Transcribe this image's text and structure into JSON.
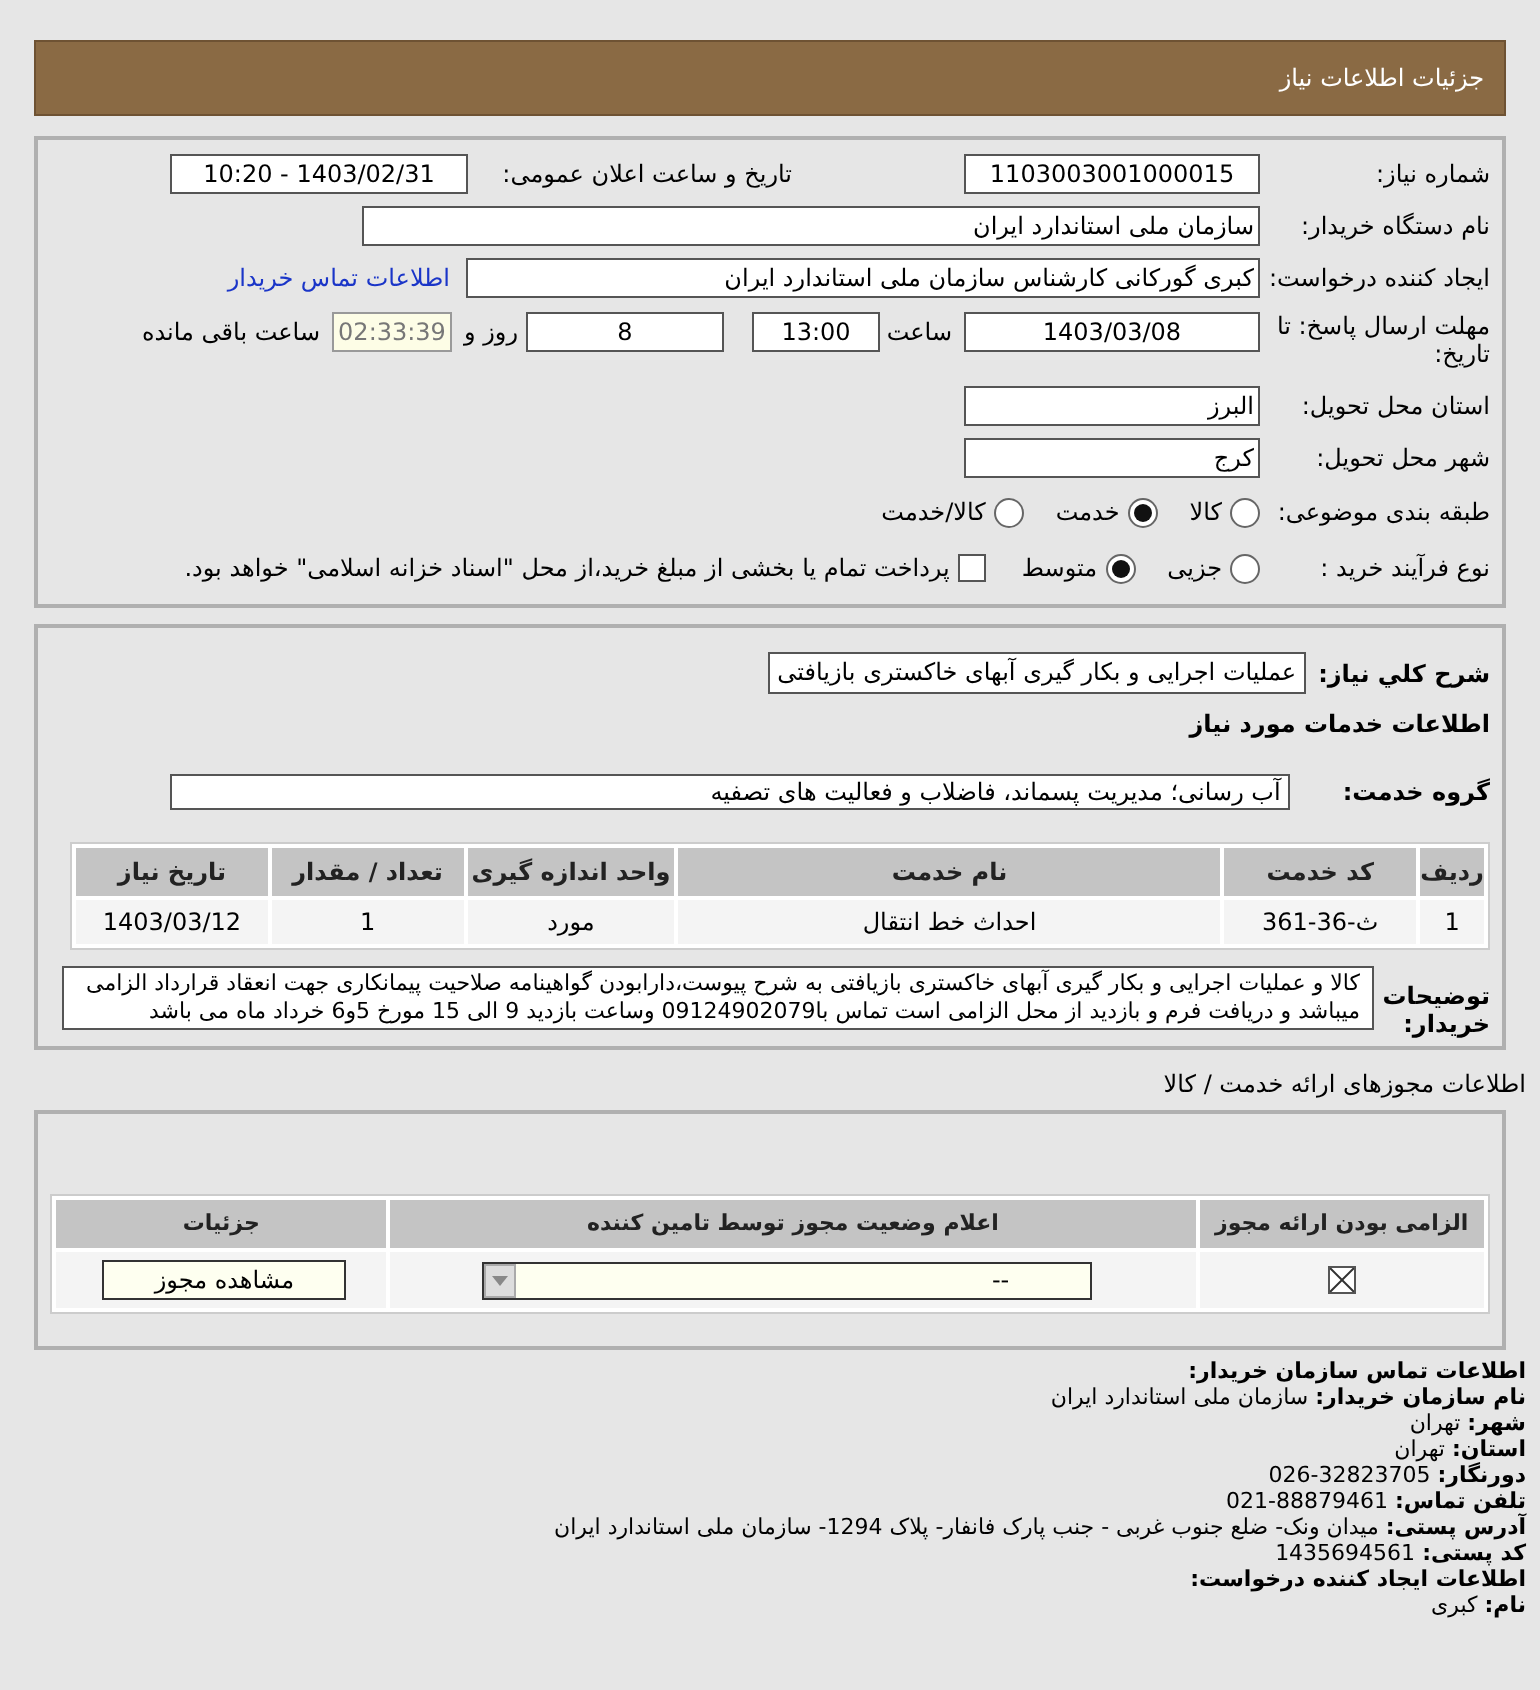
{
  "header": {
    "title": "جزئیات اطلاعات نیاز"
  },
  "need_number": {
    "label": "شماره نیاز:",
    "value": "1103003001000015"
  },
  "announce_date": {
    "label": "تاریخ و ساعت اعلان عمومی:",
    "value": "1403/02/31 - 10:20"
  },
  "buyer_org": {
    "label": "نام دستگاه خریدار:",
    "value": "سازمان ملی استاندارد ایران"
  },
  "requester": {
    "label": "ایجاد کننده درخواست:",
    "value": "کبری گورکانی کارشناس سازمان ملی استاندارد ایران",
    "link": "اطلاعات تماس خریدار"
  },
  "deadline": {
    "label": "مهلت ارسال پاسخ: تا تاریخ:",
    "date": "1403/03/08",
    "time_label": "ساعت",
    "time": "13:00",
    "days": "8",
    "days_label": "روز و",
    "remaining": "02:33:39",
    "remaining_label": "ساعت باقی مانده"
  },
  "province": {
    "label": "استان محل تحویل:",
    "value": "البرز"
  },
  "city": {
    "label": "شهر محل تحویل:",
    "value": "کرج"
  },
  "category": {
    "label": "طبقه بندی موضوعی:",
    "options": [
      {
        "label": "کالا",
        "selected": false
      },
      {
        "label": "خدمت",
        "selected": true
      },
      {
        "label": "کالا/خدمت",
        "selected": false
      }
    ]
  },
  "purchase_type": {
    "label": "نوع فرآیند خرید :",
    "options": [
      {
        "label": "جزیی",
        "selected": false
      },
      {
        "label": "متوسط",
        "selected": true
      }
    ],
    "treasury": {
      "label": "پرداخت تمام یا بخشی از مبلغ خرید،از محل \"اسناد خزانه اسلامی\" خواهد بود.",
      "checked": false
    }
  },
  "summary": {
    "label": "شرح کلي نياز:",
    "value": "عملیات اجرایی و بکار گیری آبهای خاکستری بازیافتی"
  },
  "services_title": "اطلاعات خدمات مورد نیاز",
  "service_group": {
    "label": "گروه خدمت:",
    "value": "آب رسانی؛ مدیریت پسماند، فاضلاب و فعالیت های تصفیه"
  },
  "services_table": {
    "columns": [
      "ردیف",
      "کد خدمت",
      "نام خدمت",
      "واحد اندازه گیری",
      "تعداد / مقدار",
      "تاریخ نیاز"
    ],
    "rows": [
      [
        "1",
        "ث-36-361",
        "احداث خط انتقال",
        "مورد",
        "1",
        "1403/03/12"
      ]
    ]
  },
  "buyer_notes": {
    "label": "توضیحات خریدار:",
    "value": "کالا و عملیات اجرایی و بکار گیری آبهای خاکستری بازیافتی به شرح پیوست،دارابودن گواهینامه صلاحیت پیمانکاری جهت انعقاد قرارداد الزامی میباشد و دریافت فرم و بازدید از محل الزامی است تماس با09124902079 وساعت بازدید 9 الی 15 مورخ 5و6 خرداد ماه می باشد"
  },
  "licenses": {
    "title": "اطلاعات مجوزهای ارائه خدمت / کالا",
    "columns": [
      "الزامی بودن ارائه مجوز",
      "اعلام وضعیت مجوز توسط تامین کننده",
      "جزئیات"
    ],
    "rows": [
      {
        "required": true,
        "status": "--",
        "action": "مشاهده مجوز"
      }
    ]
  },
  "contact": {
    "title": "اطلاعات تماس سازمان خریدار:",
    "lines": [
      {
        "label": "نام سازمان خریدار:",
        "value": "سازمان ملی استاندارد ایران"
      },
      {
        "label": "شهر:",
        "value": "تهران"
      },
      {
        "label": "استان:",
        "value": "تهران"
      },
      {
        "label": "دورنگار:",
        "value": "32823705-026"
      },
      {
        "label": "تلفن تماس:",
        "value": "88879461-021"
      },
      {
        "label": "آدرس پستی:",
        "value": "میدان ونک- ضلع جنوب غربی - جنب پارک فانفار- پلاک 1294- سازمان ملی استاندارد ایران"
      },
      {
        "label": "کد پستی:",
        "value": "1435694561"
      }
    ]
  },
  "requester_info": {
    "title": "اطلاعات ایجاد کننده درخواست:",
    "lines": [
      {
        "label": "نام:",
        "value": "کبری"
      }
    ]
  }
}
